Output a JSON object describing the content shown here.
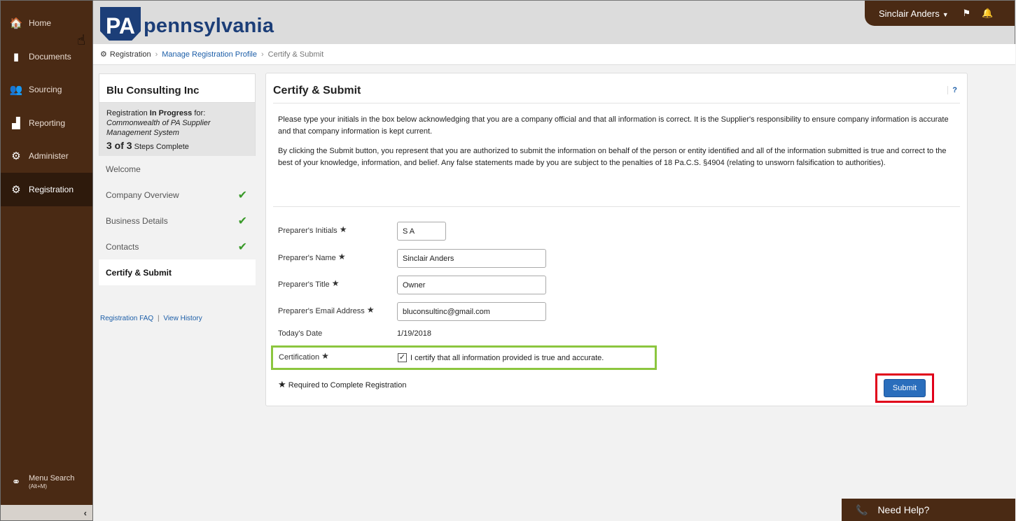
{
  "nav": {
    "items": [
      {
        "label": "Home",
        "icon": "home-icon",
        "glyph": "🏠"
      },
      {
        "label": "Documents",
        "icon": "documents-icon",
        "glyph": "▮"
      },
      {
        "label": "Sourcing",
        "icon": "sourcing-icon",
        "glyph": "👥"
      },
      {
        "label": "Reporting",
        "icon": "reporting-icon",
        "glyph": "▟"
      },
      {
        "label": "Administer",
        "icon": "administer-icon",
        "glyph": "⚙"
      },
      {
        "label": "Registration",
        "icon": "registration-icon",
        "glyph": "⚙"
      }
    ],
    "active": "Registration",
    "menu_search": {
      "label": "Menu Search",
      "shortcut": "(Alt+M)",
      "glyph": "⚭"
    },
    "collapse_glyph": "‹"
  },
  "header": {
    "logo_badge": "PA",
    "logo_word": "pennsylvania",
    "user_name": "Sinclair Anders",
    "caret": "▼",
    "flag_glyph": "⚑",
    "bell_glyph": "🔔"
  },
  "breadcrumb": {
    "root_icon": "⚙",
    "root": "Registration",
    "sep": "›",
    "link": "Manage Registration Profile",
    "current": "Certify & Submit"
  },
  "registration": {
    "company": "Blu Consulting Inc",
    "status_prefix": "Registration ",
    "status_bold": "In Progress",
    "status_suffix": " for:",
    "system": "Commonwealth of PA Supplier Management System",
    "steps_count": "3 of 3",
    "steps_suffix": " Steps Complete",
    "steps": [
      {
        "label": "Welcome",
        "done": ""
      },
      {
        "label": "Company Overview",
        "done": "✔"
      },
      {
        "label": "Business Details",
        "done": "✔"
      },
      {
        "label": "Contacts",
        "done": "✔"
      },
      {
        "label": "Certify & Submit",
        "done": ""
      }
    ],
    "faq": "Registration FAQ",
    "pipe": "|",
    "history": "View History"
  },
  "card": {
    "title": "Certify & Submit",
    "help": "?",
    "para1": "Please type your initials in the box below acknowledging that you are a company official and that all information is correct. It is the Supplier's responsibility to ensure company information is accurate and that company information is kept current.",
    "para2": "By clicking the Submit button, you represent that you are authorized to submit the information on behalf of the person or entity identified and all of the information submitted is true and correct to the best of your knowledge, information, and belief. Any false statements made by you are subject to the penalties of 18 Pa.C.S. §4904 (relating to unsworn falsification to authorities).",
    "star": "★",
    "fields": {
      "initials_label": "Preparer's Initials",
      "initials_value": "S A",
      "name_label": "Preparer's Name",
      "name_value": "Sinclair Anders",
      "title_label": "Preparer's Title",
      "title_value": "Owner",
      "email_label": "Preparer's Email Address",
      "email_value": "bluconsultinc@gmail.com",
      "date_label": "Today's Date",
      "date_value": "1/19/2018",
      "cert_label": "Certification",
      "cert_check": "✓",
      "cert_text": "I certify that all information provided is true and accurate."
    },
    "required_note": "Required to Complete Registration",
    "submit": "Submit"
  },
  "help_bar": {
    "phone_glyph": "📞",
    "label": "Need Help?"
  },
  "cursor_glyph": "☝"
}
